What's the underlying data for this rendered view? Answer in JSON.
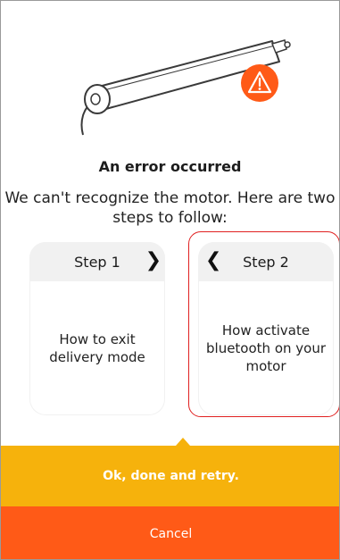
{
  "dialog": {
    "title": "An error occurred",
    "description": "We can't recognize the motor. Here are two steps to follow:"
  },
  "steps": [
    {
      "label": "Step 1",
      "text": "How to exit delivery mode",
      "nav_icon": "chevron-right-icon"
    },
    {
      "label": "Step 2",
      "text": "How activate bluetooth on your motor",
      "nav_icon": "chevron-left-icon"
    }
  ],
  "buttons": {
    "retry_label": "Ok, done and retry.",
    "cancel_label": "Cancel"
  },
  "illustration": {
    "subject": "motor-tube",
    "badge_icon": "warning-icon"
  },
  "colors": {
    "retry_bg": "#f6b20c",
    "cancel_bg": "#ff5a17",
    "warning_badge": "#ff5a17",
    "highlight": "#e02020",
    "card_header": "#f1f1f1"
  }
}
